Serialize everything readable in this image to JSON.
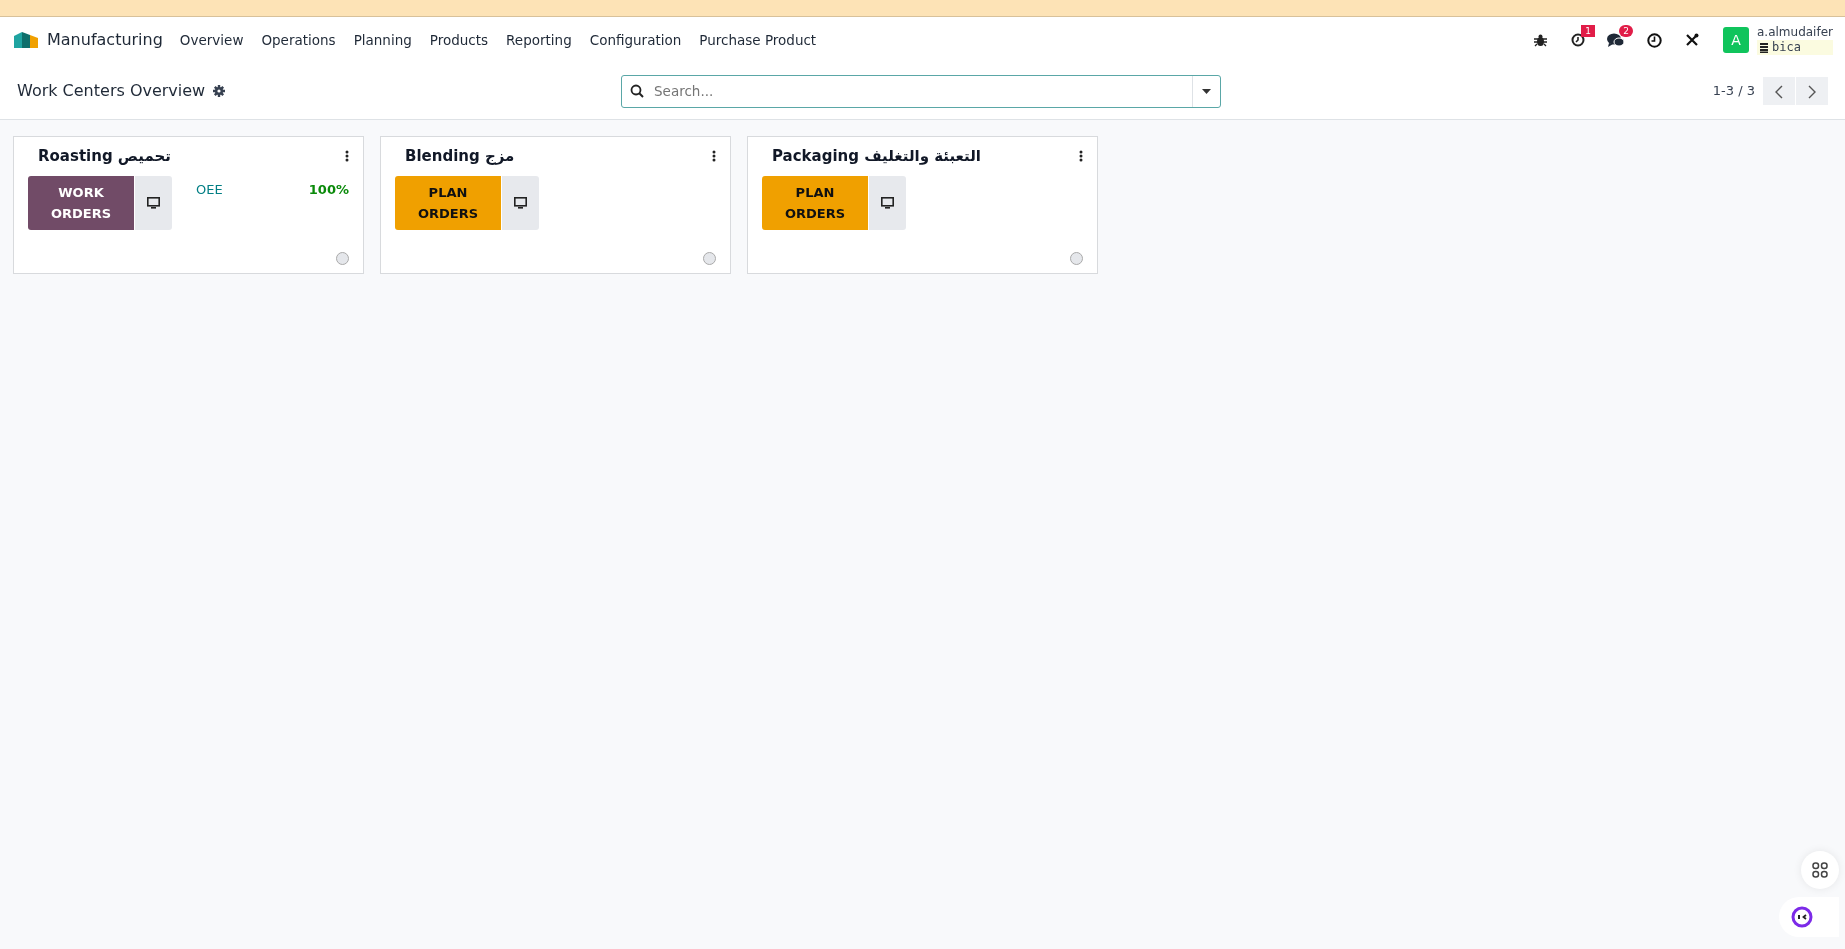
{
  "navbar": {
    "app": "Manufacturing",
    "menu": [
      "Overview",
      "Operations",
      "Planning",
      "Products",
      "Reporting",
      "Configuration",
      "Purchase Product"
    ],
    "systray": [
      {
        "kind": "bug"
      },
      {
        "kind": "activity",
        "badge": "1"
      },
      {
        "kind": "chat",
        "badge": "2"
      },
      {
        "kind": "clock"
      },
      {
        "kind": "tools"
      }
    ],
    "user": {
      "initial": "A",
      "name": "a.almudaifer",
      "database": "bica"
    }
  },
  "control_panel": {
    "title": "Work Centers Overview",
    "search": {
      "placeholder": "Search..."
    },
    "pager": "1-3 / 3"
  },
  "cards": [
    {
      "name": "Roasting تحميص",
      "button": {
        "kind": "work",
        "label": "WORK ORDERS"
      },
      "stats": [
        {
          "label": "OEE",
          "value": "100%"
        }
      ]
    },
    {
      "name": "Blending مزج",
      "button": {
        "kind": "plan",
        "label": "PLAN ORDERS"
      }
    },
    {
      "name": "Packaging التعبئة والتغليف",
      "button": {
        "kind": "plan",
        "label": "PLAN ORDERS"
      }
    }
  ]
}
